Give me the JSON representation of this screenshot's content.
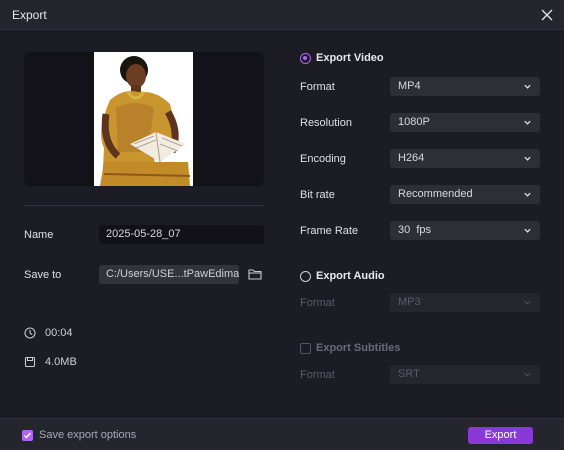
{
  "window": {
    "title": "Export"
  },
  "left": {
    "name_label": "Name",
    "name_value": "2025-05-28_07",
    "save_to_label": "Save to",
    "save_to_value": "C:/Users/USE...tPawEdimakor",
    "duration": "00:04",
    "size": "4.0MB"
  },
  "video": {
    "heading": "Export Video",
    "rows": [
      {
        "label": "Format",
        "value": "MP4"
      },
      {
        "label": "Resolution",
        "value": "1080P"
      },
      {
        "label": "Encoding",
        "value": "H264"
      },
      {
        "label": "Bit rate",
        "value": "Recommended"
      },
      {
        "label": "Frame Rate",
        "value": "30  fps"
      }
    ]
  },
  "audio": {
    "heading": "Export Audio",
    "format_label": "Format",
    "format_value": "MP3"
  },
  "subtitles": {
    "heading": "Export Subtitles",
    "format_label": "Format",
    "format_value": "SRT"
  },
  "footer": {
    "save_options_label": "Save export options",
    "export_label": "Export"
  },
  "colors": {
    "accent": "#8a39d8",
    "accent_light": "#b063f0",
    "background": "#1c1c24"
  }
}
